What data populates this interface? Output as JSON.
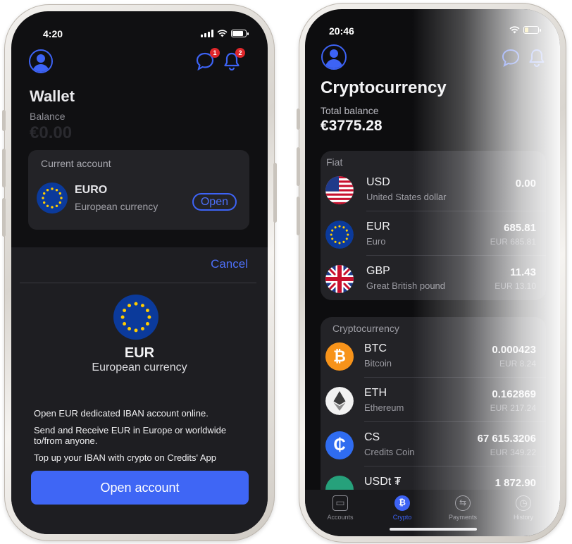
{
  "left": {
    "status": {
      "time": "4:20"
    },
    "header": {
      "chat_badge": "1",
      "bell_badge": "2"
    },
    "wallet": {
      "title": "Wallet",
      "balance_label": "Balance",
      "balance": "€0.00"
    },
    "current_account": {
      "label": "Current account",
      "name": "EURO",
      "subtitle": "European currency",
      "open_label": "Open"
    },
    "sheet": {
      "cancel_label": "Cancel",
      "currency_code": "EUR",
      "currency_name": "European currency",
      "info": [
        "Open EUR dedicated IBAN account online.",
        "Send and Receive EUR in Europe or worldwide to/from anyone.",
        "Top up your IBAN with crypto on Credits' App"
      ],
      "cta_label": "Open account"
    }
  },
  "right": {
    "status": {
      "time": "20:46"
    },
    "title": "Cryptocurrency",
    "total_label": "Total balance",
    "total": "€3775.28",
    "fiat": {
      "header": "Fiat",
      "rows": [
        {
          "code": "USD",
          "name": "United States dollar",
          "amount": "0.00",
          "eur": ""
        },
        {
          "code": "EUR",
          "name": "Euro",
          "amount": "685.81",
          "eur": "EUR 685.81"
        },
        {
          "code": "GBP",
          "name": "Great British pound",
          "amount": "11.43",
          "eur": "EUR 13.10"
        }
      ]
    },
    "crypto": {
      "header": "Cryptocurrency",
      "rows": [
        {
          "code": "BTC",
          "name": "Bitcoin",
          "amount": "0.000423",
          "eur": "EUR 8.24"
        },
        {
          "code": "ETH",
          "name": "Ethereum",
          "amount": "0.162869",
          "eur": "EUR 217.24"
        },
        {
          "code": "CS",
          "name": "Credits Coin",
          "amount": "67 615.3206",
          "eur": "EUR 349.22"
        },
        {
          "code": "USDt ₮",
          "name": "",
          "amount": "1 872.90",
          "eur": ""
        }
      ]
    },
    "tabs": [
      {
        "label": "Accounts",
        "glyph": "▭"
      },
      {
        "label": "Crypto",
        "glyph": "₿"
      },
      {
        "label": "Payments",
        "glyph": "⇆"
      },
      {
        "label": "History",
        "glyph": "◷"
      }
    ],
    "colors": {
      "accent": "#3d63f5",
      "badge": "#e0272b",
      "btc": "#f7931a",
      "cs": "#2f6cf0",
      "usdt": "#26a17b"
    }
  }
}
